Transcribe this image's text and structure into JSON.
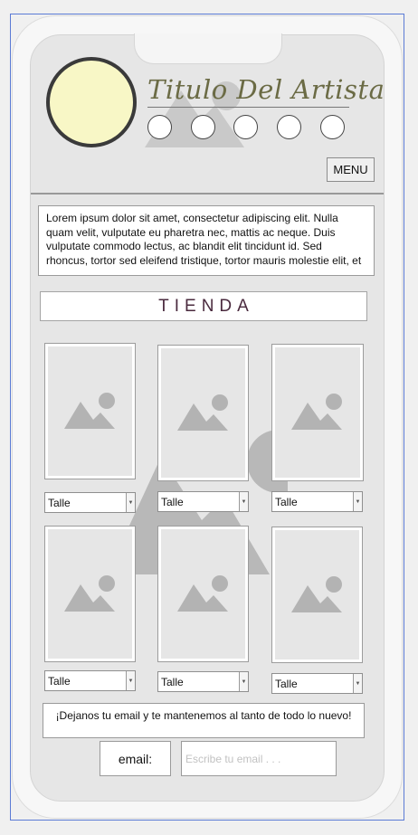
{
  "header": {
    "artist_title": "Titulo Del Artista",
    "menu_label": "MENU",
    "social_icons": [
      "social-link-1",
      "social-link-2",
      "social-link-3",
      "social-link-4",
      "social-link-5"
    ]
  },
  "description": "Lorem ipsum dolor sit amet, consectetur adipiscing elit. Nulla quam velit, vulputate eu pharetra nec, mattis ac neque. Duis vulputate commodo lectus, ac blandit elit tincidunt id. Sed rhoncus, tortor sed eleifend tristique, tortor mauris molestie elit, et",
  "store": {
    "title": "TIENDA",
    "products": [
      {
        "size_select": "Talle"
      },
      {
        "size_select": "Talle"
      },
      {
        "size_select": "Talle"
      },
      {
        "size_select": "Talle"
      },
      {
        "size_select": "Talle"
      },
      {
        "size_select": "Talle"
      }
    ]
  },
  "newsletter": {
    "message": "¡Dejanos tu email y te mantenemos al tanto de todo lo nuevo!",
    "email_label": "email:",
    "email_placeholder": "Escribe tu email . . .",
    "email_value": ""
  },
  "colors": {
    "avatar_fill": "#f8f7c6",
    "title_text": "#6b6b45",
    "tienda_text": "#4a2a3e",
    "frame_outline": "#5b7bd5"
  }
}
